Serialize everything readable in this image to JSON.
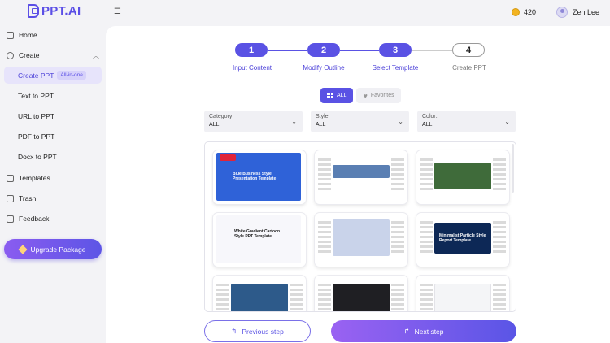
{
  "app": {
    "logo_text": "PPT.AI"
  },
  "header": {
    "coins": "420",
    "user_name": "Zen Lee"
  },
  "sidebar": {
    "home": "Home",
    "create": "Create",
    "create_ppt": "Create PPT",
    "create_ppt_badge": "All-in-one",
    "text_to_ppt": "Text to PPT",
    "url_to_ppt": "URL to PPT",
    "pdf_to_ppt": "PDF to PPT",
    "docx_to_ppt": "Docx to PPT",
    "templates": "Templates",
    "trash": "Trash",
    "feedback": "Feedback",
    "upgrade": "Upgrade Package"
  },
  "steps": [
    {
      "num": "1",
      "label": "Input Content",
      "state": "done"
    },
    {
      "num": "2",
      "label": "Modify Outline",
      "state": "done"
    },
    {
      "num": "3",
      "label": "Select Template",
      "state": "active"
    },
    {
      "num": "4",
      "label": "Create PPT",
      "state": "pending"
    }
  ],
  "view_toggle": {
    "all": "ALL",
    "favorites": "Favorites"
  },
  "filters": [
    {
      "label": "Category:",
      "value": "ALL"
    },
    {
      "label": "Style:",
      "value": "ALL"
    },
    {
      "label": "Color:",
      "value": "ALL"
    }
  ],
  "templates": [
    {
      "title": "Blue Business Style Presentation Template",
      "color": "#2f62d8"
    },
    {
      "title": "",
      "color": "#5a7fb3"
    },
    {
      "title": "",
      "color": "#3f6b3a"
    },
    {
      "title": "White Gradient Cartoon Style PPT Template",
      "color": "#ffffff"
    },
    {
      "title": "",
      "color": "#c9d3ea"
    },
    {
      "title": "Minimalist Particle Style Report Template",
      "color": "#0d2856"
    },
    {
      "title": "",
      "color": "#2d5a8a"
    },
    {
      "title": "",
      "color": "#1f1f23"
    },
    {
      "title": "",
      "color": "#f4f5f7"
    }
  ],
  "footer": {
    "prev": "Previous step",
    "next": "Next step"
  },
  "colors": {
    "accent": "#5a52e4",
    "accent_light": "#e7e4fb"
  }
}
